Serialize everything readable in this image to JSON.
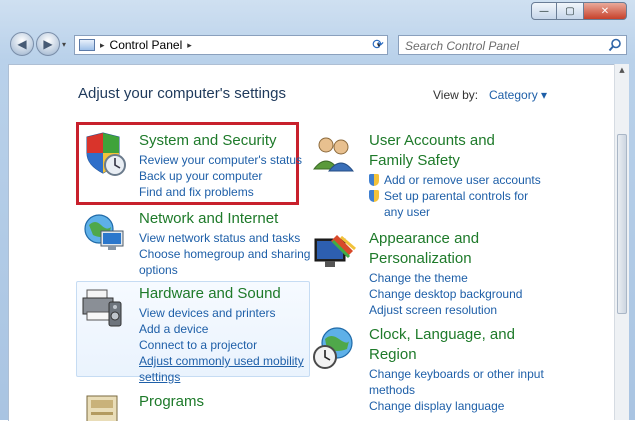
{
  "window": {
    "minimize_glyph": "—",
    "maximize_glyph": "▢",
    "close_glyph": "✕"
  },
  "nav": {
    "back_glyph": "◀",
    "forward_glyph": "▶",
    "recent_glyph": "▾",
    "address_separator": "▸",
    "address_path": "Control Panel",
    "address_trailing_separator": "▸",
    "address_dropdown_glyph": "▾",
    "refresh_glyph": "⟳",
    "search_placeholder": "Search Control Panel"
  },
  "header": {
    "heading": "Adjust your computer's settings",
    "view_by_label": "View by:",
    "view_by_value": "Category ▾"
  },
  "categories": [
    {
      "title": "System and Security",
      "icon": "system-security-icon",
      "links": [
        "Review your computer's status",
        "Back up your computer",
        "Find and fix problems"
      ]
    },
    {
      "title": "Network and Internet",
      "icon": "network-internet-icon",
      "links": [
        "View network status and tasks",
        "Choose homegroup and sharing",
        "options"
      ]
    },
    {
      "title": "Hardware and Sound",
      "icon": "hardware-sound-icon",
      "links": [
        "View devices and printers",
        "Add a device",
        "Connect to a projector",
        "Adjust commonly used mobility",
        "settings"
      ]
    },
    {
      "title": "Programs",
      "icon": "programs-icon",
      "links": []
    },
    {
      "title_line1": "User Accounts and",
      "title_line2": "Family Safety",
      "icon": "user-accounts-icon",
      "links": [
        "Add or remove user accounts",
        "Set up parental controls for",
        "any user"
      ]
    },
    {
      "title_line1": "Appearance and",
      "title_line2": "Personalization",
      "icon": "appearance-icon",
      "links": [
        "Change the theme",
        "Change desktop background",
        "Adjust screen resolution"
      ]
    },
    {
      "title_line1": "Clock, Language, and",
      "title_line2": "Region",
      "icon": "clock-language-icon",
      "links": [
        "Change keyboards or other input",
        "methods",
        "Change display language"
      ]
    }
  ],
  "colors": {
    "category_title": "#1e7a2a",
    "link": "#1e5fa8",
    "highlight": "#c8202c"
  }
}
